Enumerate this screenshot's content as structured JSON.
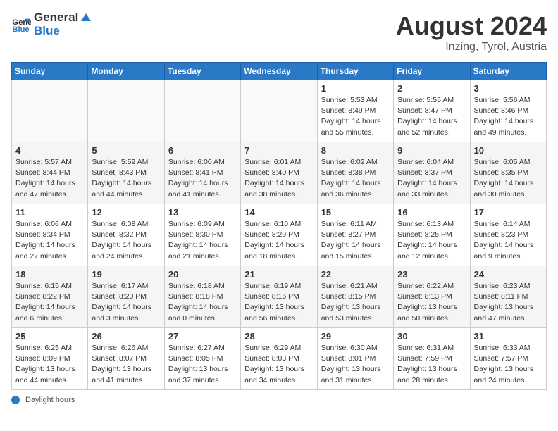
{
  "header": {
    "logo_general": "General",
    "logo_blue": "Blue",
    "title": "August 2024",
    "subtitle": "Inzing, Tyrol, Austria"
  },
  "calendar": {
    "days_of_week": [
      "Sunday",
      "Monday",
      "Tuesday",
      "Wednesday",
      "Thursday",
      "Friday",
      "Saturday"
    ],
    "weeks": [
      [
        {
          "day": "",
          "info": ""
        },
        {
          "day": "",
          "info": ""
        },
        {
          "day": "",
          "info": ""
        },
        {
          "day": "",
          "info": ""
        },
        {
          "day": "1",
          "info": "Sunrise: 5:53 AM\nSunset: 8:49 PM\nDaylight: 14 hours and 55 minutes."
        },
        {
          "day": "2",
          "info": "Sunrise: 5:55 AM\nSunset: 8:47 PM\nDaylight: 14 hours and 52 minutes."
        },
        {
          "day": "3",
          "info": "Sunrise: 5:56 AM\nSunset: 8:46 PM\nDaylight: 14 hours and 49 minutes."
        }
      ],
      [
        {
          "day": "4",
          "info": "Sunrise: 5:57 AM\nSunset: 8:44 PM\nDaylight: 14 hours and 47 minutes."
        },
        {
          "day": "5",
          "info": "Sunrise: 5:59 AM\nSunset: 8:43 PM\nDaylight: 14 hours and 44 minutes."
        },
        {
          "day": "6",
          "info": "Sunrise: 6:00 AM\nSunset: 8:41 PM\nDaylight: 14 hours and 41 minutes."
        },
        {
          "day": "7",
          "info": "Sunrise: 6:01 AM\nSunset: 8:40 PM\nDaylight: 14 hours and 38 minutes."
        },
        {
          "day": "8",
          "info": "Sunrise: 6:02 AM\nSunset: 8:38 PM\nDaylight: 14 hours and 36 minutes."
        },
        {
          "day": "9",
          "info": "Sunrise: 6:04 AM\nSunset: 8:37 PM\nDaylight: 14 hours and 33 minutes."
        },
        {
          "day": "10",
          "info": "Sunrise: 6:05 AM\nSunset: 8:35 PM\nDaylight: 14 hours and 30 minutes."
        }
      ],
      [
        {
          "day": "11",
          "info": "Sunrise: 6:06 AM\nSunset: 8:34 PM\nDaylight: 14 hours and 27 minutes."
        },
        {
          "day": "12",
          "info": "Sunrise: 6:08 AM\nSunset: 8:32 PM\nDaylight: 14 hours and 24 minutes."
        },
        {
          "day": "13",
          "info": "Sunrise: 6:09 AM\nSunset: 8:30 PM\nDaylight: 14 hours and 21 minutes."
        },
        {
          "day": "14",
          "info": "Sunrise: 6:10 AM\nSunset: 8:29 PM\nDaylight: 14 hours and 18 minutes."
        },
        {
          "day": "15",
          "info": "Sunrise: 6:11 AM\nSunset: 8:27 PM\nDaylight: 14 hours and 15 minutes."
        },
        {
          "day": "16",
          "info": "Sunrise: 6:13 AM\nSunset: 8:25 PM\nDaylight: 14 hours and 12 minutes."
        },
        {
          "day": "17",
          "info": "Sunrise: 6:14 AM\nSunset: 8:23 PM\nDaylight: 14 hours and 9 minutes."
        }
      ],
      [
        {
          "day": "18",
          "info": "Sunrise: 6:15 AM\nSunset: 8:22 PM\nDaylight: 14 hours and 6 minutes."
        },
        {
          "day": "19",
          "info": "Sunrise: 6:17 AM\nSunset: 8:20 PM\nDaylight: 14 hours and 3 minutes."
        },
        {
          "day": "20",
          "info": "Sunrise: 6:18 AM\nSunset: 8:18 PM\nDaylight: 14 hours and 0 minutes."
        },
        {
          "day": "21",
          "info": "Sunrise: 6:19 AM\nSunset: 8:16 PM\nDaylight: 13 hours and 56 minutes."
        },
        {
          "day": "22",
          "info": "Sunrise: 6:21 AM\nSunset: 8:15 PM\nDaylight: 13 hours and 53 minutes."
        },
        {
          "day": "23",
          "info": "Sunrise: 6:22 AM\nSunset: 8:13 PM\nDaylight: 13 hours and 50 minutes."
        },
        {
          "day": "24",
          "info": "Sunrise: 6:23 AM\nSunset: 8:11 PM\nDaylight: 13 hours and 47 minutes."
        }
      ],
      [
        {
          "day": "25",
          "info": "Sunrise: 6:25 AM\nSunset: 8:09 PM\nDaylight: 13 hours and 44 minutes."
        },
        {
          "day": "26",
          "info": "Sunrise: 6:26 AM\nSunset: 8:07 PM\nDaylight: 13 hours and 41 minutes."
        },
        {
          "day": "27",
          "info": "Sunrise: 6:27 AM\nSunset: 8:05 PM\nDaylight: 13 hours and 37 minutes."
        },
        {
          "day": "28",
          "info": "Sunrise: 6:29 AM\nSunset: 8:03 PM\nDaylight: 13 hours and 34 minutes."
        },
        {
          "day": "29",
          "info": "Sunrise: 6:30 AM\nSunset: 8:01 PM\nDaylight: 13 hours and 31 minutes."
        },
        {
          "day": "30",
          "info": "Sunrise: 6:31 AM\nSunset: 7:59 PM\nDaylight: 13 hours and 28 minutes."
        },
        {
          "day": "31",
          "info": "Sunrise: 6:33 AM\nSunset: 7:57 PM\nDaylight: 13 hours and 24 minutes."
        }
      ]
    ]
  },
  "footer": {
    "note": "Daylight hours"
  }
}
